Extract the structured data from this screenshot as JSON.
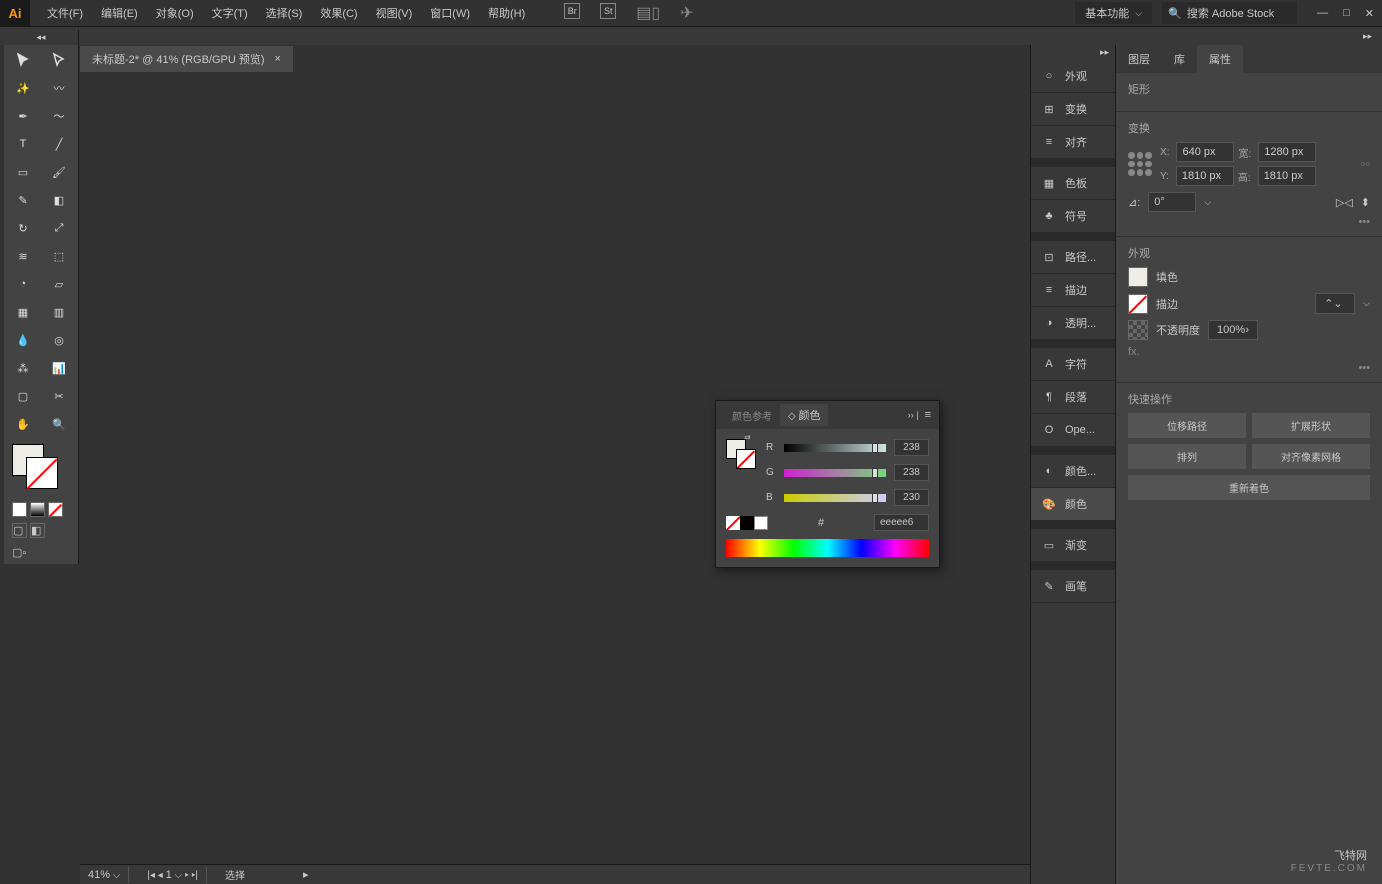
{
  "app": {
    "logo": "Ai"
  },
  "menu": [
    "文件(F)",
    "编辑(E)",
    "对象(O)",
    "文字(T)",
    "选择(S)",
    "效果(C)",
    "视图(V)",
    "窗口(W)",
    "帮助(H)"
  ],
  "menu_icons": [
    "Br",
    "St"
  ],
  "workspace": {
    "label": "基本功能"
  },
  "search": {
    "placeholder": "搜索 Adobe Stock"
  },
  "doc_tab": {
    "title": "未标题-2* @ 41% (RGB/GPU 预览)"
  },
  "status": {
    "zoom": "41%",
    "page": "1",
    "mode": "选择"
  },
  "dock": [
    {
      "label": "外观",
      "icon": "○"
    },
    {
      "label": "变换",
      "icon": "⊞"
    },
    {
      "label": "对齐",
      "icon": "≡"
    },
    {
      "label": "色板",
      "icon": "▦"
    },
    {
      "label": "符号",
      "icon": "♣"
    },
    {
      "label": "路径...",
      "icon": "⊡"
    },
    {
      "label": "描边",
      "icon": "≡"
    },
    {
      "label": "透明...",
      "icon": "◑"
    },
    {
      "label": "字符",
      "icon": "A"
    },
    {
      "label": "段落",
      "icon": "¶"
    },
    {
      "label": "Ope...",
      "icon": "O"
    },
    {
      "label": "颜色...",
      "icon": "◐"
    },
    {
      "label": "颜色",
      "icon": "🎨",
      "active": true
    },
    {
      "label": "渐变",
      "icon": "▭"
    },
    {
      "label": "画笔",
      "icon": "✎"
    }
  ],
  "prop_tabs": [
    "图层",
    "库",
    "属性"
  ],
  "prop": {
    "shape_label": "矩形",
    "transform_label": "变换",
    "x_label": "X:",
    "x": "640 px",
    "y_label": "Y:",
    "y": "1810 px",
    "w_label": "宽:",
    "w": "1280 px",
    "h_label": "高:",
    "h": "1810 px",
    "rotate": "0°",
    "appearance_label": "外观",
    "fill_label": "填色",
    "stroke_label": "描边",
    "opacity_label": "不透明度",
    "opacity": "100%",
    "fx": "fx.",
    "quick_label": "快速操作",
    "btn_offset": "位移路径",
    "btn_expand": "扩展形状",
    "btn_arrange": "排列",
    "btn_align_pixel": "对齐像素网格",
    "btn_recolor": "重新着色"
  },
  "color_panel": {
    "tab_guide": "颜色参考",
    "tab_color": "颜色",
    "r_label": "R",
    "r": "238",
    "g_label": "G",
    "g": "238",
    "b_label": "B",
    "b": "230",
    "hex_label": "#",
    "hex": "eeeee6"
  },
  "watermark": {
    "main": "飞特网",
    "sub": "FEVTE.COM"
  }
}
